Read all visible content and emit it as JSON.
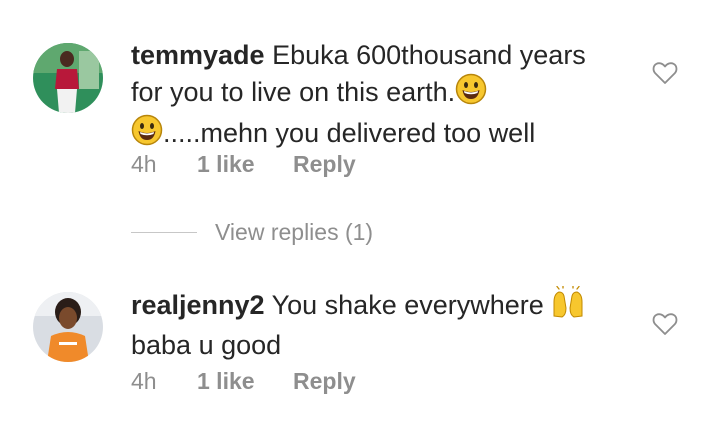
{
  "comments": [
    {
      "username": "temmyade",
      "text_part1": " Ebuka 600thousand years for you to live on this earth.",
      "emoji1": "grinning-face",
      "emoji2": "grinning-face",
      "text_part2": ".....mehn you delivered too well",
      "time": "4h",
      "likes": "1 like",
      "reply_label": "Reply",
      "view_replies": "View replies (1)"
    },
    {
      "username": "realjenny2",
      "text_part1": " You shake everywhere ",
      "emoji1": "raising-hands",
      "text_part2": "baba u good",
      "time": "4h",
      "likes": "1 like",
      "reply_label": "Reply"
    }
  ],
  "colors": {
    "text": "#262626",
    "secondary": "#8e8e8e",
    "emoji": "#f7c72e"
  }
}
